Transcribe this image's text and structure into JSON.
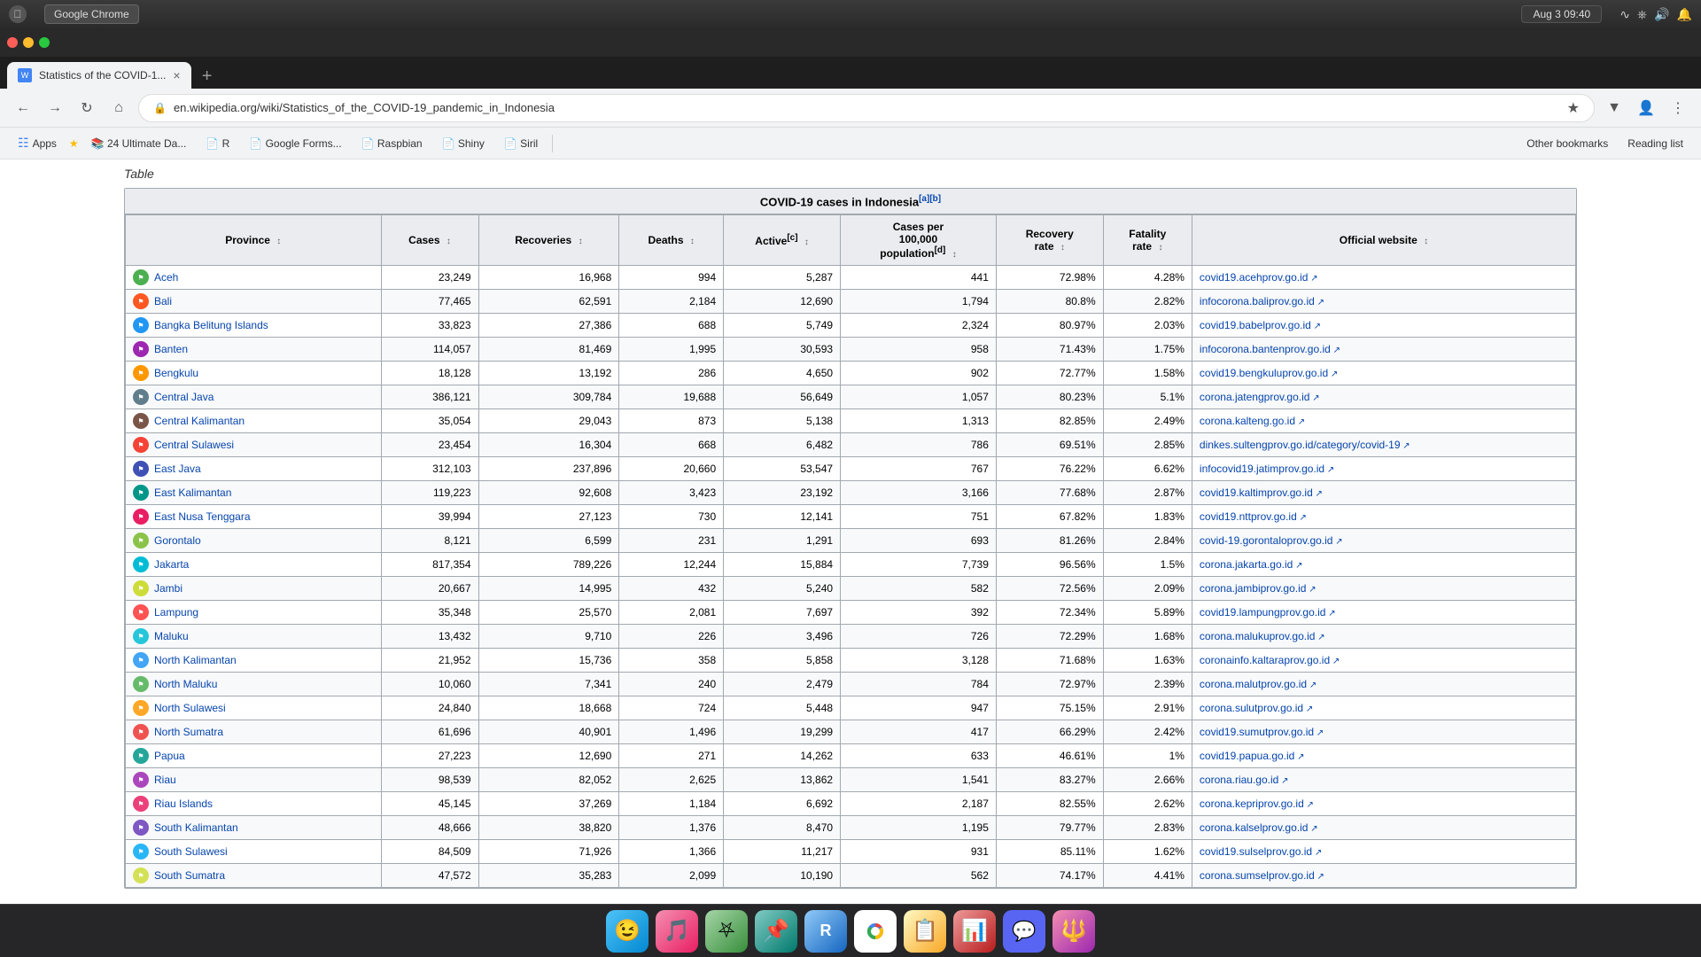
{
  "macos": {
    "apple_label": "",
    "chrome_label": "Google Chrome",
    "time": "Aug 3  09:40"
  },
  "browser": {
    "tab_title": "Statistics of the COVID-1...",
    "url": "en.wikipedia.org/wiki/Statistics_of_the_COVID-19_pandemic_in_Indonesia",
    "bookmarks": [
      "Apps",
      "24 Ultimate Da...",
      "R",
      "Google Forms...",
      "Raspbian",
      "Shiny",
      "Siril",
      "Other bookmarks",
      "Reading list"
    ]
  },
  "page": {
    "header_text": "Table",
    "table_title": "COVID-19 cases in Indonesia",
    "columns": [
      "Province",
      "Cases",
      "Recoveries",
      "Deaths",
      "Active[c]",
      "Cases per 100,000 population[d]",
      "Recovery rate",
      "Fatality rate",
      "Official website"
    ],
    "rows": [
      {
        "province": "Aceh",
        "cases": "23,249",
        "recoveries": "16,968",
        "deaths": "994",
        "active": "5,287",
        "per100k": "441",
        "recovery_rate": "72.98%",
        "fatality_rate": "4.28%",
        "website": "covid19.acehprov.go.id"
      },
      {
        "province": "Bali",
        "cases": "77,465",
        "recoveries": "62,591",
        "deaths": "2,184",
        "active": "12,690",
        "per100k": "1,794",
        "recovery_rate": "80.8%",
        "fatality_rate": "2.82%",
        "website": "infocorona.baliprov.go.id"
      },
      {
        "province": "Bangka Belitung Islands",
        "cases": "33,823",
        "recoveries": "27,386",
        "deaths": "688",
        "active": "5,749",
        "per100k": "2,324",
        "recovery_rate": "80.97%",
        "fatality_rate": "2.03%",
        "website": "covid19.babelprov.go.id"
      },
      {
        "province": "Banten",
        "cases": "114,057",
        "recoveries": "81,469",
        "deaths": "1,995",
        "active": "30,593",
        "per100k": "958",
        "recovery_rate": "71.43%",
        "fatality_rate": "1.75%",
        "website": "infocorona.bantenprov.go.id"
      },
      {
        "province": "Bengkulu",
        "cases": "18,128",
        "recoveries": "13,192",
        "deaths": "286",
        "active": "4,650",
        "per100k": "902",
        "recovery_rate": "72.77%",
        "fatality_rate": "1.58%",
        "website": "covid19.bengkuluprov.go.id"
      },
      {
        "province": "Central Java",
        "cases": "386,121",
        "recoveries": "309,784",
        "deaths": "19,688",
        "active": "56,649",
        "per100k": "1,057",
        "recovery_rate": "80.23%",
        "fatality_rate": "5.1%",
        "website": "corona.jatengprov.go.id"
      },
      {
        "province": "Central Kalimantan",
        "cases": "35,054",
        "recoveries": "29,043",
        "deaths": "873",
        "active": "5,138",
        "per100k": "1,313",
        "recovery_rate": "82.85%",
        "fatality_rate": "2.49%",
        "website": "corona.kalteng.go.id"
      },
      {
        "province": "Central Sulawesi",
        "cases": "23,454",
        "recoveries": "16,304",
        "deaths": "668",
        "active": "6,482",
        "per100k": "786",
        "recovery_rate": "69.51%",
        "fatality_rate": "2.85%",
        "website": "dinkes.sultengprov.go.id/category/covid-19"
      },
      {
        "province": "East Java",
        "cases": "312,103",
        "recoveries": "237,896",
        "deaths": "20,660",
        "active": "53,547",
        "per100k": "767",
        "recovery_rate": "76.22%",
        "fatality_rate": "6.62%",
        "website": "infocovid19.jatimprov.go.id"
      },
      {
        "province": "East Kalimantan",
        "cases": "119,223",
        "recoveries": "92,608",
        "deaths": "3,423",
        "active": "23,192",
        "per100k": "3,166",
        "recovery_rate": "77.68%",
        "fatality_rate": "2.87%",
        "website": "covid19.kaltimprov.go.id"
      },
      {
        "province": "East Nusa Tenggara",
        "cases": "39,994",
        "recoveries": "27,123",
        "deaths": "730",
        "active": "12,141",
        "per100k": "751",
        "recovery_rate": "67.82%",
        "fatality_rate": "1.83%",
        "website": "covid19.nttprov.go.id"
      },
      {
        "province": "Gorontalo",
        "cases": "8,121",
        "recoveries": "6,599",
        "deaths": "231",
        "active": "1,291",
        "per100k": "693",
        "recovery_rate": "81.26%",
        "fatality_rate": "2.84%",
        "website": "covid-19.gorontaloprov.go.id"
      },
      {
        "province": "Jakarta",
        "cases": "817,354",
        "recoveries": "789,226",
        "deaths": "12,244",
        "active": "15,884",
        "per100k": "7,739",
        "recovery_rate": "96.56%",
        "fatality_rate": "1.5%",
        "website": "corona.jakarta.go.id"
      },
      {
        "province": "Jambi",
        "cases": "20,667",
        "recoveries": "14,995",
        "deaths": "432",
        "active": "5,240",
        "per100k": "582",
        "recovery_rate": "72.56%",
        "fatality_rate": "2.09%",
        "website": "corona.jambiprov.go.id"
      },
      {
        "province": "Lampung",
        "cases": "35,348",
        "recoveries": "25,570",
        "deaths": "2,081",
        "active": "7,697",
        "per100k": "392",
        "recovery_rate": "72.34%",
        "fatality_rate": "5.89%",
        "website": "covid19.lampungprov.go.id"
      },
      {
        "province": "Maluku",
        "cases": "13,432",
        "recoveries": "9,710",
        "deaths": "226",
        "active": "3,496",
        "per100k": "726",
        "recovery_rate": "72.29%",
        "fatality_rate": "1.68%",
        "website": "corona.malukuprov.go.id"
      },
      {
        "province": "North Kalimantan",
        "cases": "21,952",
        "recoveries": "15,736",
        "deaths": "358",
        "active": "5,858",
        "per100k": "3,128",
        "recovery_rate": "71.68%",
        "fatality_rate": "1.63%",
        "website": "coronainfo.kaltaraprov.go.id"
      },
      {
        "province": "North Maluku",
        "cases": "10,060",
        "recoveries": "7,341",
        "deaths": "240",
        "active": "2,479",
        "per100k": "784",
        "recovery_rate": "72.97%",
        "fatality_rate": "2.39%",
        "website": "corona.malutprov.go.id"
      },
      {
        "province": "North Sulawesi",
        "cases": "24,840",
        "recoveries": "18,668",
        "deaths": "724",
        "active": "5,448",
        "per100k": "947",
        "recovery_rate": "75.15%",
        "fatality_rate": "2.91%",
        "website": "corona.sulutprov.go.id"
      },
      {
        "province": "North Sumatra",
        "cases": "61,696",
        "recoveries": "40,901",
        "deaths": "1,496",
        "active": "19,299",
        "per100k": "417",
        "recovery_rate": "66.29%",
        "fatality_rate": "2.42%",
        "website": "covid19.sumutprov.go.id"
      },
      {
        "province": "Papua",
        "cases": "27,223",
        "recoveries": "12,690",
        "deaths": "271",
        "active": "14,262",
        "per100k": "633",
        "recovery_rate": "46.61%",
        "fatality_rate": "1%",
        "website": "covid19.papua.go.id"
      },
      {
        "province": "Riau",
        "cases": "98,539",
        "recoveries": "82,052",
        "deaths": "2,625",
        "active": "13,862",
        "per100k": "1,541",
        "recovery_rate": "83.27%",
        "fatality_rate": "2.66%",
        "website": "corona.riau.go.id"
      },
      {
        "province": "Riau Islands",
        "cases": "45,145",
        "recoveries": "37,269",
        "deaths": "1,184",
        "active": "6,692",
        "per100k": "2,187",
        "recovery_rate": "82.55%",
        "fatality_rate": "2.62%",
        "website": "corona.kepriprov.go.id"
      },
      {
        "province": "South Kalimantan",
        "cases": "48,666",
        "recoveries": "38,820",
        "deaths": "1,376",
        "active": "8,470",
        "per100k": "1,195",
        "recovery_rate": "79.77%",
        "fatality_rate": "2.83%",
        "website": "corona.kalselprov.go.id"
      },
      {
        "province": "South Sulawesi",
        "cases": "84,509",
        "recoveries": "71,926",
        "deaths": "1,366",
        "active": "11,217",
        "per100k": "931",
        "recovery_rate": "85.11%",
        "fatality_rate": "1.62%",
        "website": "covid19.sulselprov.go.id"
      },
      {
        "province": "South Sumatra",
        "cases": "47,572",
        "recoveries": "35,283",
        "deaths": "2,099",
        "active": "10,190",
        "per100k": "562",
        "recovery_rate": "74.17%",
        "fatality_rate": "4.41%",
        "website": "corona.sumselprov.go.id"
      }
    ]
  },
  "dock": {
    "items": [
      "Finder",
      "Music",
      "Codegreen",
      "Find My",
      "RStudio",
      "Chrome",
      "Notes",
      "Numbers",
      "Discord",
      "Launchpad"
    ]
  }
}
